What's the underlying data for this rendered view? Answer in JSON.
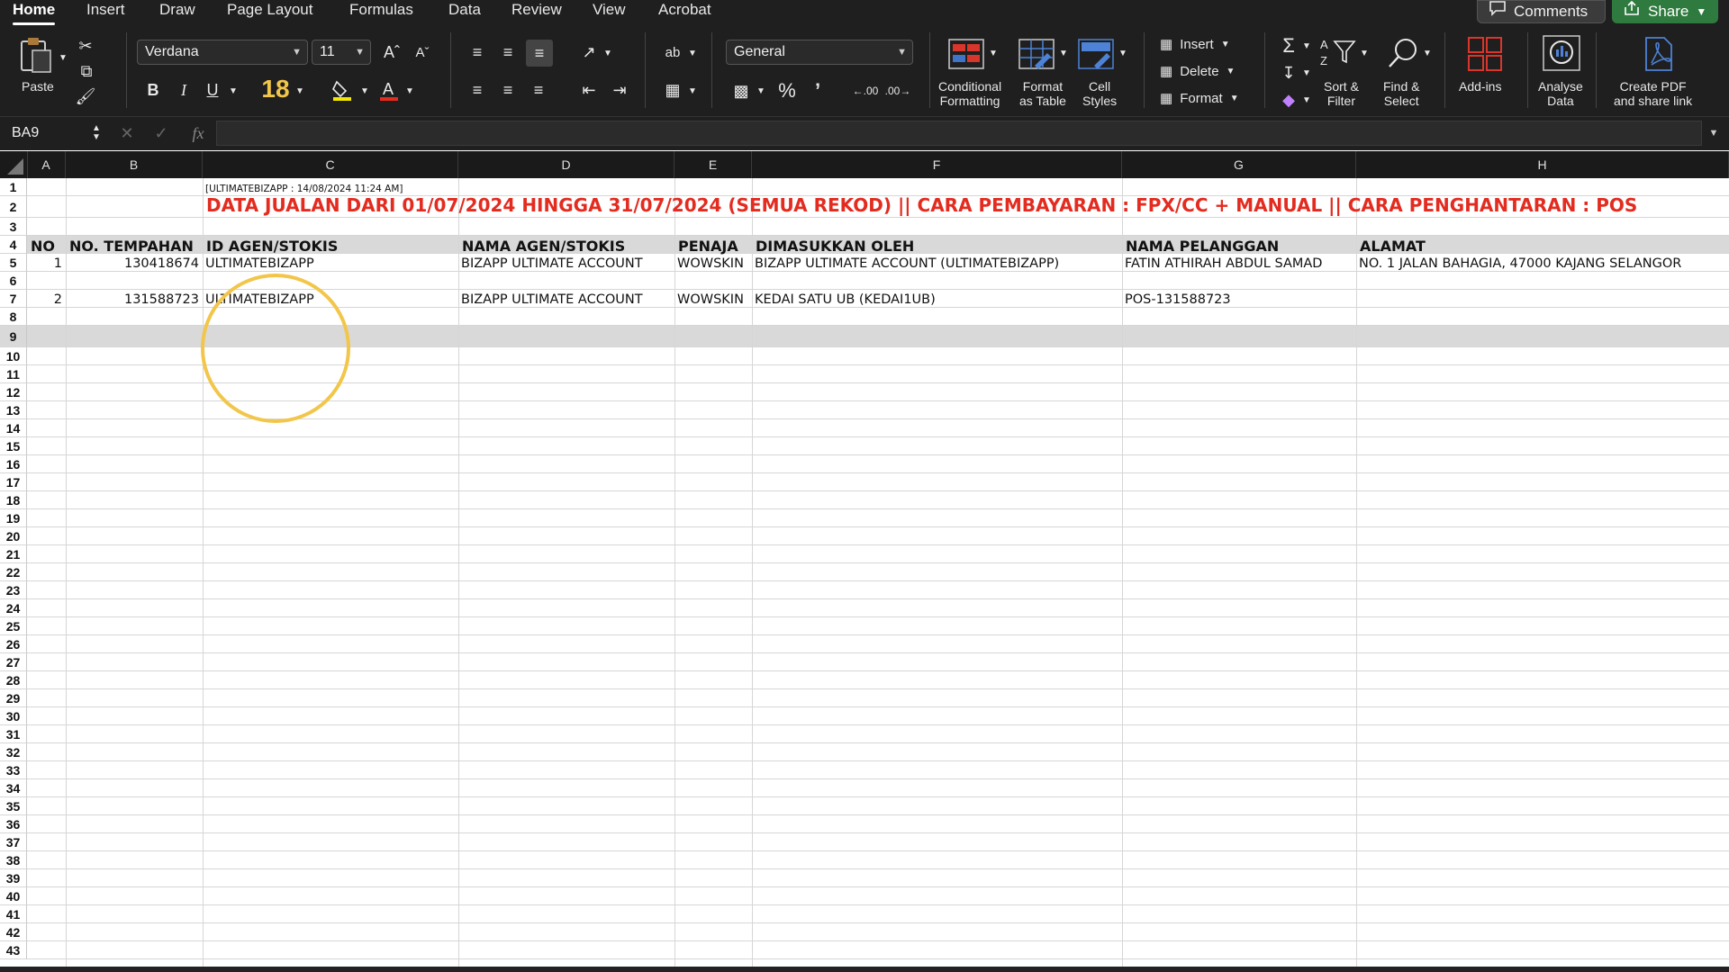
{
  "ribbon": {
    "tabs": [
      "Home",
      "Insert",
      "Draw",
      "Page Layout",
      "Formulas",
      "Data",
      "Review",
      "View",
      "Acrobat"
    ],
    "comments_label": "Comments",
    "share_label": "Share",
    "paste_label": "Paste",
    "font_name": "Verdana",
    "font_size": "11",
    "font_size_highlight": "18",
    "number_format": "General",
    "conditional_formatting": "Conditional\nFormatting",
    "format_as_table": "Format\nas Table",
    "cell_styles": "Cell\nStyles",
    "insert_label": "Insert",
    "delete_label": "Delete",
    "format_label": "Format",
    "sort_filter": "Sort &\nFilter",
    "find_select": "Find &\nSelect",
    "add_ins": "Add-ins",
    "analyse_data": "Analyse\nData",
    "create_pdf": "Create PDF\nand share link",
    "bold": "B",
    "italic": "I",
    "underline": "U",
    "percent": "%"
  },
  "formula_bar": {
    "name_box": "BA9",
    "fx": "fx"
  },
  "columns": [
    "A",
    "B",
    "C",
    "D",
    "E",
    "F",
    "G",
    "H"
  ],
  "rows": [
    "1",
    "2",
    "3",
    "4",
    "5",
    "6",
    "7",
    "8",
    "9",
    "10",
    "11",
    "12",
    "13",
    "14",
    "15",
    "16",
    "17",
    "18",
    "19",
    "20",
    "21",
    "22",
    "23",
    "24",
    "25",
    "26",
    "27",
    "28",
    "29",
    "30",
    "31",
    "32",
    "33",
    "34",
    "35",
    "36",
    "37",
    "38",
    "39",
    "40",
    "41",
    "42",
    "43"
  ],
  "sheet": {
    "stamp": "[ULTIMATEBIZAPP : 14/08/2024 11:24 AM]",
    "title": "DATA JUALAN DARI 01/07/2024 HINGGA 31/07/2024 (SEMUA REKOD)  || CARA PEMBAYARAN : FPX/CC + MANUAL  || CARA PENGHANTARAN : POS",
    "headers": [
      "NO",
      "NO. TEMPAHAN",
      "ID AGEN/STOKIS",
      "NAMA AGEN/STOKIS",
      "PENAJA",
      "DIMASUKKAN OLEH",
      "NAMA PELANGGAN",
      "ALAMAT"
    ],
    "records": [
      {
        "no": "1",
        "order": "130418674",
        "agent_id": "ULTIMATEBIZAPP",
        "agent_name": "BIZAPP ULTIMATE ACCOUNT",
        "sponsor": "WOWSKIN",
        "entered_by": "BIZAPP ULTIMATE ACCOUNT (ULTIMATEBIZAPP)",
        "customer": "FATIN ATHIRAH ABDUL SAMAD",
        "address": "NO. 1 JALAN BAHAGIA, 47000 KAJANG SELANGOR"
      },
      {
        "no": "2",
        "order": "131588723",
        "agent_id": "ULTIMATEBIZAPP",
        "agent_name": "BIZAPP ULTIMATE ACCOUNT",
        "sponsor": "WOWSKIN",
        "entered_by": "KEDAI SATU UB (KEDAI1UB)",
        "customer": "POS-131588723",
        "address": ""
      }
    ]
  }
}
